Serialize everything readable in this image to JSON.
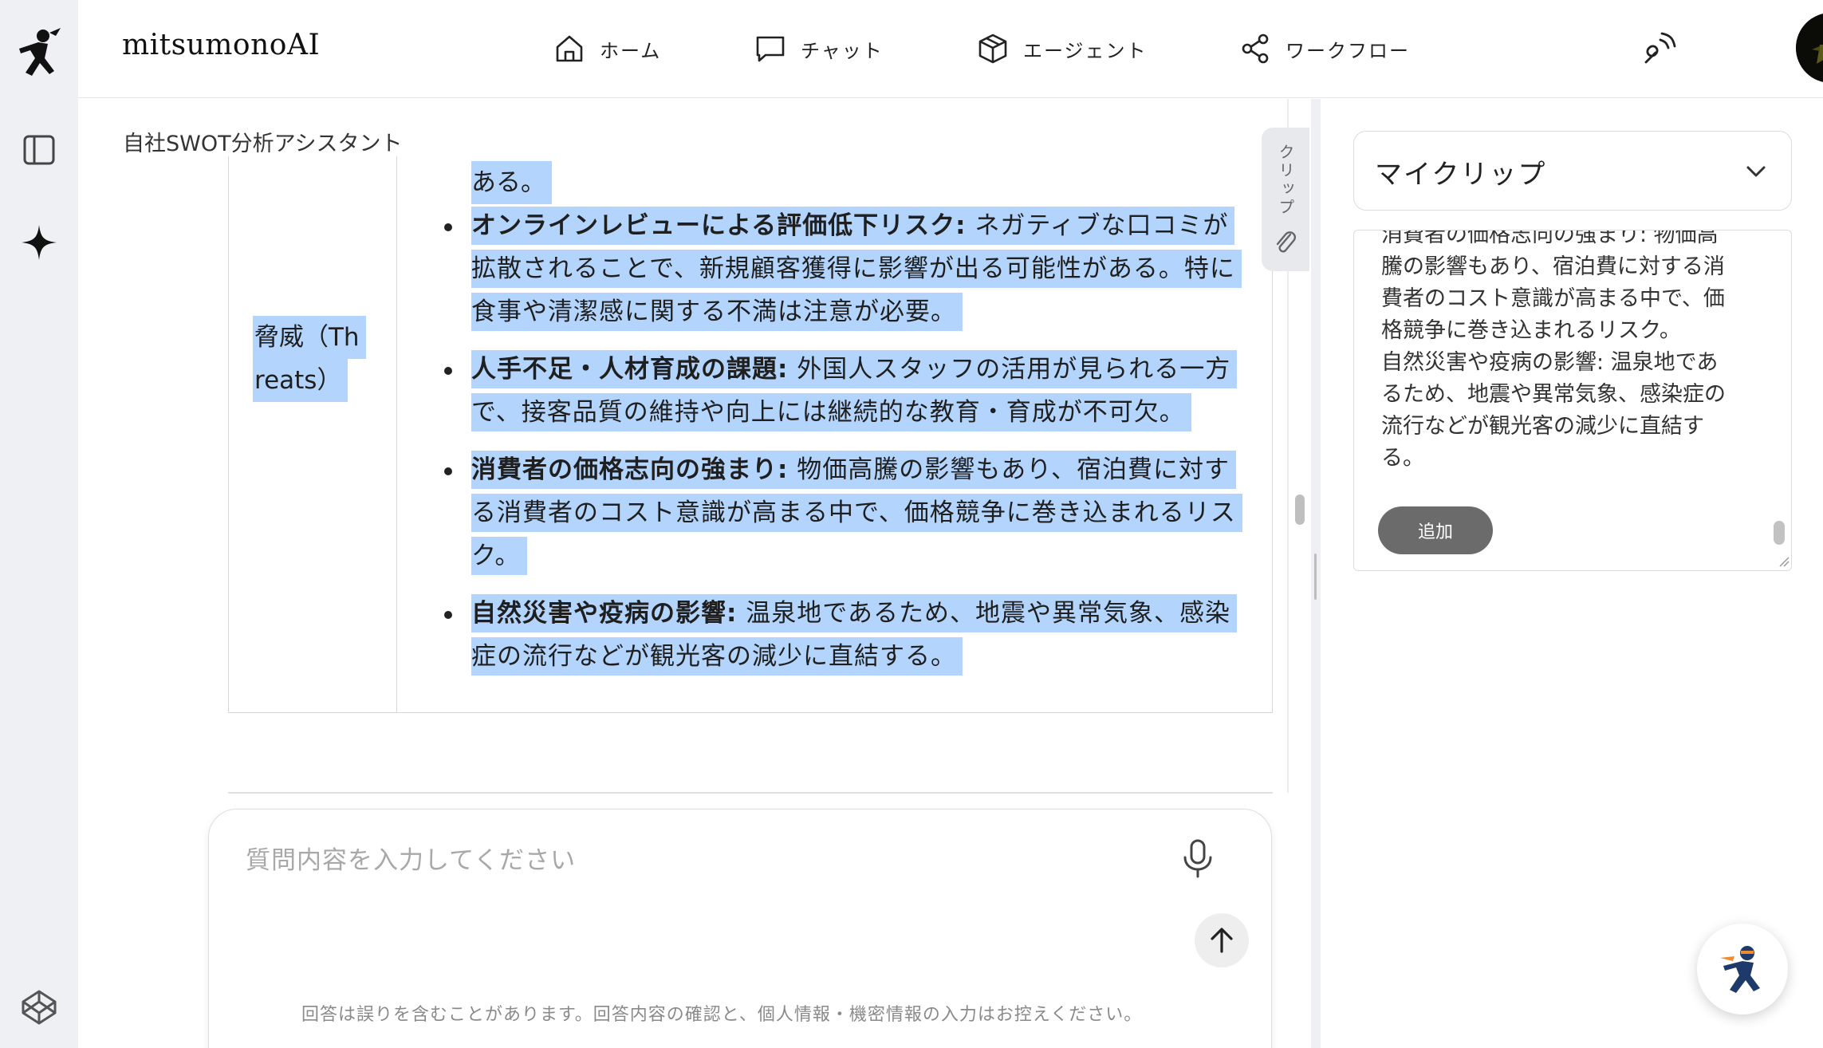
{
  "app": {
    "brand": "mitsumonoAI"
  },
  "nav": [
    {
      "label": "ホーム",
      "icon": "home-icon"
    },
    {
      "label": "チャット",
      "icon": "chat-icon"
    },
    {
      "label": "エージェント",
      "icon": "cube-icon"
    },
    {
      "label": "ワークフロー",
      "icon": "share-icon"
    }
  ],
  "chat": {
    "breadcrumb": "自社SWOT分析アシスタント",
    "table": {
      "category_line1": "脅威（Th",
      "category_line2": "reats）",
      "fragment": "ある。",
      "bullets": [
        {
          "bold": "オンラインレビューによる評価低下リスク:",
          "text": " ネガティブな口コミが拡散されることで、新規顧客獲得に影響が出る可能性がある。特に食事や清潔感に関する不満は注意が必要。"
        },
        {
          "bold": "人手不足・人材育成の課題:",
          "text": " 外国人スタッフの活用が見られる一方で、接客品質の維持や向上には継続的な教育・育成が不可欠。"
        },
        {
          "bold": "消費者の価格志向の強まり:",
          "text": " 物価高騰の影響もあり、宿泊費に対する消費者のコスト意識が高まる中で、価格競争に巻き込まれるリスク。"
        },
        {
          "bold": "自然災害や疫病の影響:",
          "text": " 温泉地であるため、地震や異常気象、感染症の流行などが観光客の減少に直結する。"
        }
      ]
    },
    "input": {
      "placeholder": "質問内容を入力してください",
      "value": ""
    },
    "disclaimer": "回答は誤りを含むことがあります。回答内容の確認と、個人情報・機密情報の入力はお控えください。",
    "clip_tab_label": "クリップ"
  },
  "clip_panel": {
    "selected": "マイクリップ",
    "lines": [
      "消費者の価格志向の強まり: 物価高",
      "騰の影響もあり、宿泊費に対する消",
      "費者のコスト意識が高まる中で、価",
      "格競争に巻き込まれるリスク。",
      "自然災害や疫病の影響: 温泉地であ",
      "るため、地震や異常気象、感染症の",
      "流行などが観光客の減少に直結す",
      "る。"
    ],
    "add_label": "追加"
  },
  "colors": {
    "selection": "#b3d4fc",
    "rail": "#eef0f4",
    "add_button": "#6b6b6b"
  }
}
